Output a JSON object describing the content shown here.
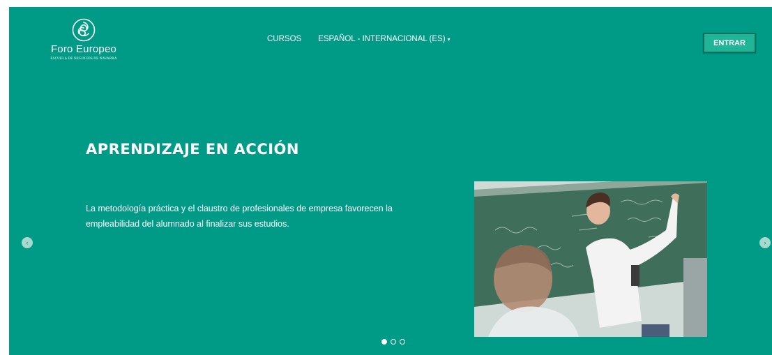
{
  "brand": {
    "name": "Foro Europeo",
    "subtitle": "ESCUELA DE NEGOCIOS DE NAVARRA",
    "icon": "knot-logo-icon"
  },
  "nav": {
    "courses_label": "CURSOS",
    "language_label": "ESPAÑOL - INTERNACIONAL (ES)",
    "language_caret": "▾"
  },
  "header": {
    "login_label": "ENTRAR"
  },
  "slide": {
    "title": "APRENDIZAJE EN ACCIÓN",
    "text": "La metodología práctica y el claustro de profesionales de empresa favorecen la empleabilidad del alumnado al finalizar sus estudios.",
    "image": "student-writing-on-chalkboard",
    "current_index": 1,
    "total": 3
  },
  "carousel": {
    "prev_icon": "‹",
    "next_icon": "›"
  },
  "colors": {
    "primary": "#009b86",
    "button": "#20b597"
  }
}
